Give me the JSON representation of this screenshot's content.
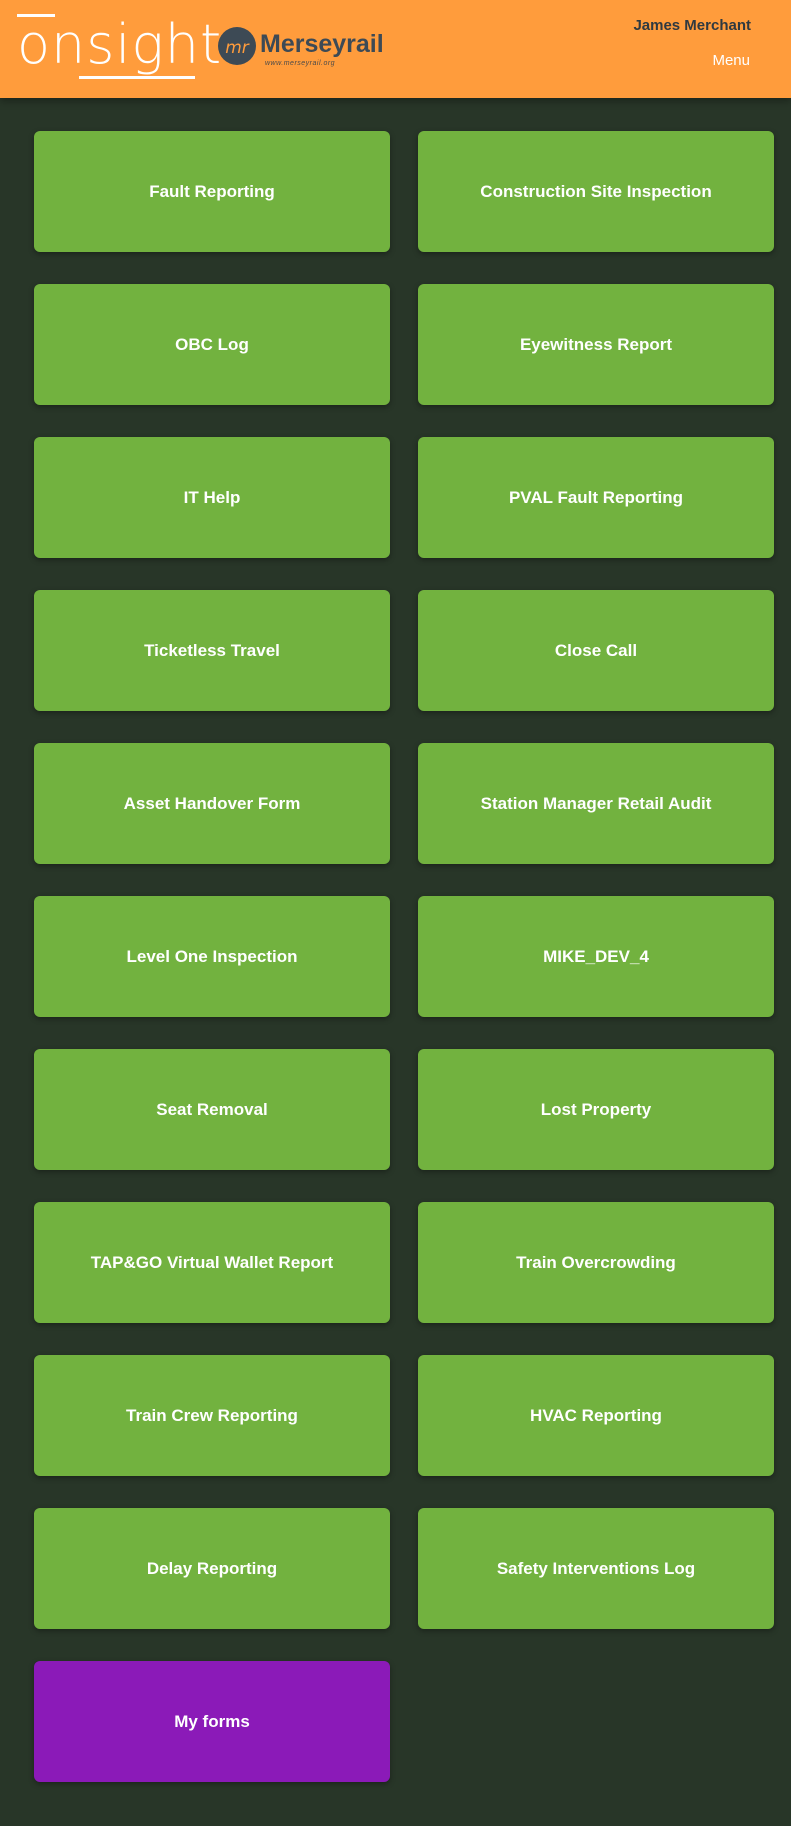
{
  "header": {
    "app_logo_text": "onsight",
    "partner_logo_text": "Merseyrail",
    "partner_logo_mark": "mr",
    "partner_tagline": "www.merseyrail.org",
    "user_name": "James Merchant",
    "menu_label": "Menu"
  },
  "colors": {
    "header_bg": "#ff9c3c",
    "page_bg": "#283628",
    "tile_green": "#72b23f",
    "tile_purple": "#8b1ab8"
  },
  "tiles": [
    {
      "label": "Fault Reporting"
    },
    {
      "label": "Construction Site Inspection"
    },
    {
      "label": "OBC Log"
    },
    {
      "label": "Eyewitness Report"
    },
    {
      "label": "IT Help"
    },
    {
      "label": "PVAL Fault Reporting"
    },
    {
      "label": "Ticketless Travel"
    },
    {
      "label": "Close Call"
    },
    {
      "label": "Asset Handover Form"
    },
    {
      "label": "Station Manager Retail Audit"
    },
    {
      "label": "Level One Inspection"
    },
    {
      "label": "MIKE_DEV_4"
    },
    {
      "label": "Seat Removal"
    },
    {
      "label": "Lost Property"
    },
    {
      "label": "TAP&GO Virtual Wallet Report"
    },
    {
      "label": "Train Overcrowding"
    },
    {
      "label": "Train Crew Reporting"
    },
    {
      "label": "HVAC Reporting"
    },
    {
      "label": "Delay Reporting"
    },
    {
      "label": "Safety Interventions Log"
    },
    {
      "label": "My forms"
    }
  ]
}
